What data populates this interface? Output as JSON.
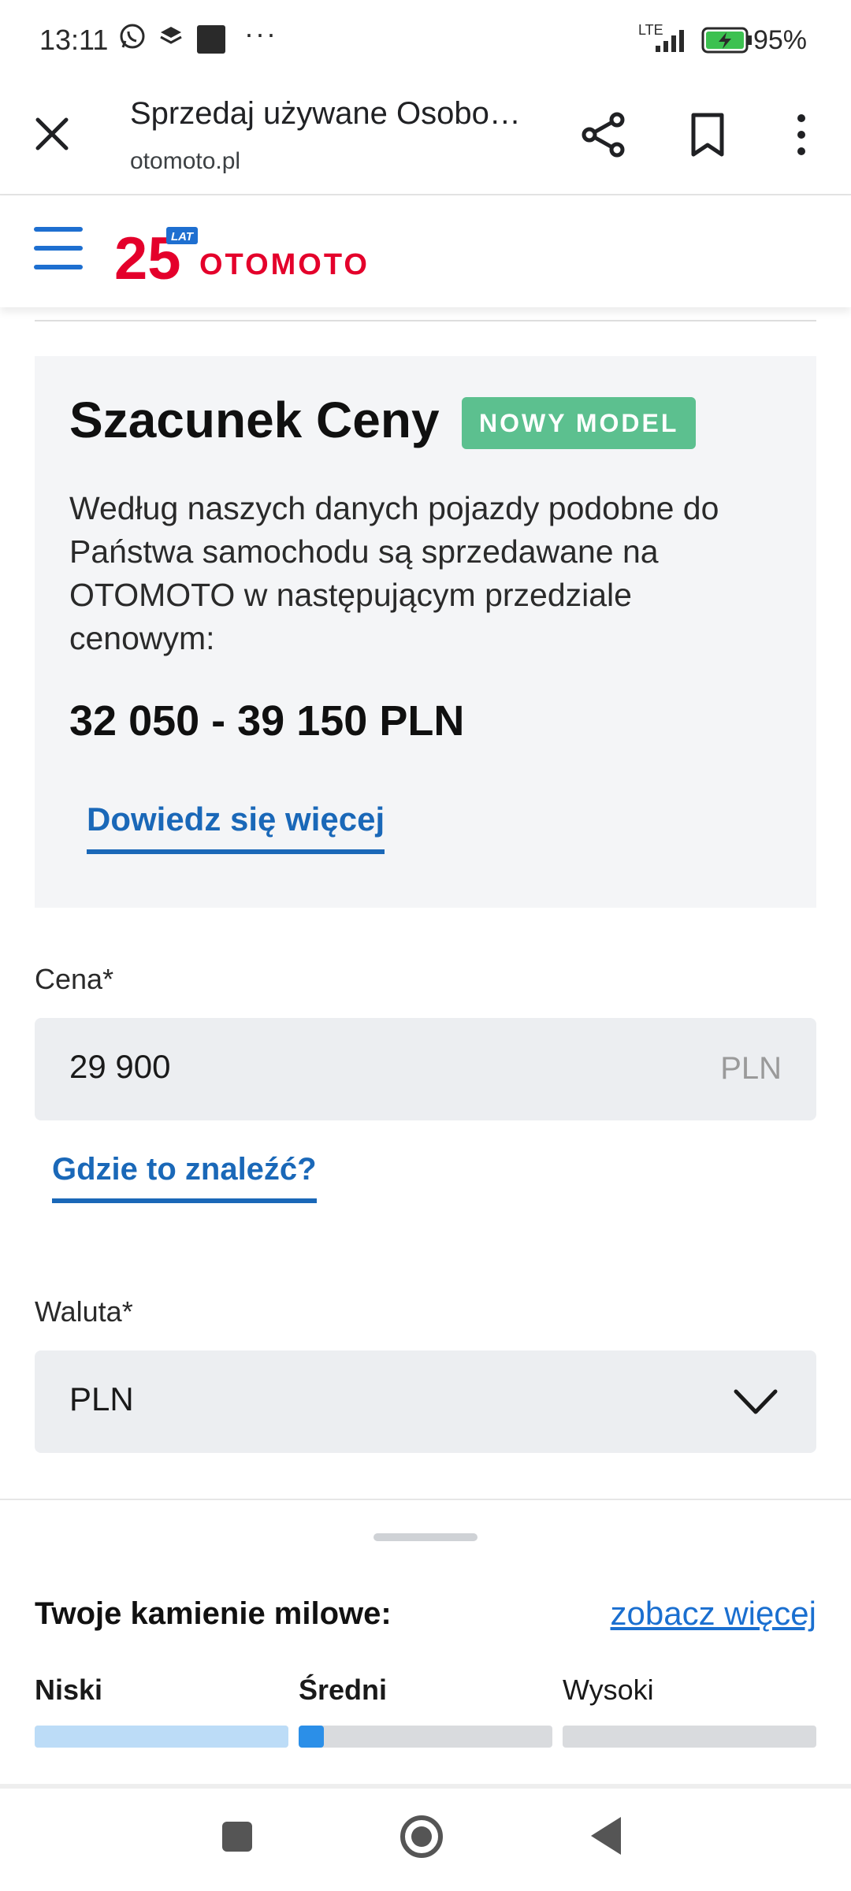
{
  "status_bar": {
    "time": "13:11",
    "network": "LTE",
    "battery": "95%"
  },
  "browser": {
    "title": "Sprzedaj używane Osobo…",
    "url": "otomoto.pl"
  },
  "site": {
    "logo_text": "OTOMOTO",
    "logo_anniv_number": "25",
    "logo_anniv_label": "LAT",
    "brand_red": "#e4002b",
    "brand_blue": "#1e6fd0"
  },
  "estimate": {
    "title": "Szacunek Ceny",
    "badge": "NOWY MODEL",
    "description": "Według naszych danych pojazdy podobne do Państwa samochodu są sprzedawane na OTOMOTO w następującym przedziale cenowym:",
    "range": "32 050 - 39 150 PLN",
    "link": "Dowiedz się więcej"
  },
  "price_field": {
    "label": "Cena*",
    "value": "29 900",
    "suffix": "PLN",
    "help_link": "Gdzie to znaleźć?"
  },
  "currency_field": {
    "label": "Waluta*",
    "value": "PLN"
  },
  "milestones": {
    "title": "Twoje kamienie milowe:",
    "more_link": "zobacz więcej",
    "levels": [
      {
        "label": "Niski",
        "progress": 1.0,
        "color": "#bcdcf7"
      },
      {
        "label": "Średni",
        "progress": 0.1,
        "color": "#2b8fe8"
      },
      {
        "label": "Wysoki",
        "progress": 0.0,
        "color": "#2b8fe8"
      }
    ]
  }
}
